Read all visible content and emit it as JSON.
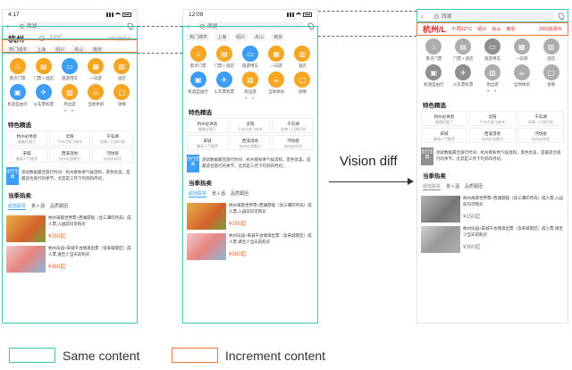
{
  "phone_left": {
    "time": "4:17",
    "search_text": "西湖",
    "city": "杭州",
    "city_temp": "12°C",
    "city_right": "1063张票片",
    "hot_label": "热门城市",
    "hot_cities": [
      "上海",
      "绍兴",
      "舟山",
      "南京"
    ],
    "icons": [
      {
        "label": "景点门票",
        "icon": "temple-icon",
        "color": "orange"
      },
      {
        "label": "门票＋酒店",
        "icon": "ticket-hotel-icon",
        "color": "orange"
      },
      {
        "label": "旅游用车",
        "icon": "car-icon",
        "color": "blue"
      },
      {
        "label": "一日游",
        "icon": "calendar-icon",
        "color": "orange"
      },
      {
        "label": "酒店",
        "icon": "hotel-icon",
        "color": "orange"
      },
      {
        "label": "机酒自由行",
        "icon": "luggage-icon",
        "color": "blue"
      },
      {
        "label": "火车票机票",
        "icon": "plane-icon",
        "color": "blue"
      },
      {
        "label": "周边游",
        "icon": "map-icon",
        "color": "orange"
      },
      {
        "label": "当地休闲",
        "icon": "leisure-icon",
        "color": "orange"
      },
      {
        "label": "攻略",
        "icon": "guide-icon",
        "color": "orange"
      }
    ],
    "featured_title": "特色精选",
    "featured": [
      {
        "title": "杭州必体验",
        "sub": "最最优惠了"
      },
      {
        "title": "灵隐",
        "sub": "千年古刹飞来寺"
      },
      {
        "title": "千岛湖",
        "sub": "经典一日游行程"
      },
      {
        "title": "宋城",
        "sub": "最高人气推荐"
      },
      {
        "title": "西溪湿地",
        "sub": "杭州必游景点"
      },
      {
        "title": "河坊街",
        "sub": "杭州必体验"
      }
    ],
    "promo_tag": "出行宝典",
    "promo_text": "测试数据最佳旅行时间：杭州春秋季气候温和，景色优美，是最适合旅行的季节。尤其是三月下旬到四月初。",
    "hot_title": "当季热卖",
    "tabs": [
      "超值联票",
      "景＋酒",
      "品质跟团"
    ],
    "products": [
      {
        "title": "杭州海底世界票+西湖游船（含三潭印月岛）成人票,入园前均可购买",
        "price": "¥150起"
      },
      {
        "title": "杭州乐园+宋城千古情演出票（含宋城景区）成人票,请至少当天前购买",
        "price": "¥360起"
      }
    ]
  },
  "phone_mid": {
    "time": "12:09"
  },
  "phone_right": {
    "city": "杭州/L",
    "city_temp": "小雨12°C",
    "diff_tabs": [
      "绍兴",
      "舟山",
      "南京"
    ],
    "city_right": "1063张票片"
  },
  "vision_label": "Vision diff",
  "legend": {
    "same": "Same content",
    "increment": "Increment content",
    "same_color": "#3cc7b6",
    "increment_color": "#f0763a"
  }
}
